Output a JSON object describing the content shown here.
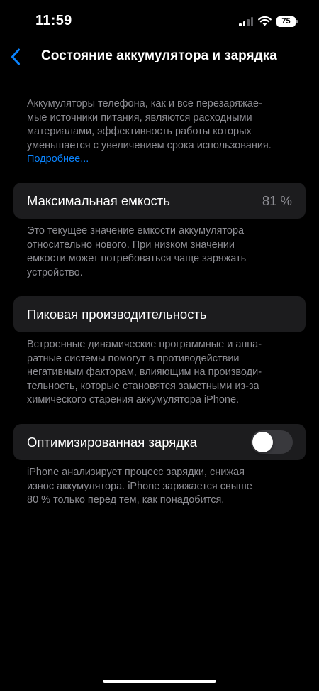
{
  "status_bar": {
    "time": "11:59",
    "battery_level": "75"
  },
  "nav": {
    "title": "Состояние аккумулятора и зарядка"
  },
  "intro": {
    "lines": [
      "Аккумуляторы телефона, как и все перезаряжае-",
      "мые источники питания, являются расходными",
      "материалами, эффективность работы которых",
      "уменьшается с увеличением срока использования."
    ],
    "link_label": "Подробнее..."
  },
  "max_capacity": {
    "label": "Максимальная емкость",
    "value": "81 %",
    "footnote": [
      "Это текущее значение емкости аккумулятора",
      "относительно нового. При низком значении",
      "емкости может потребоваться чаще заряжать",
      "устройство."
    ]
  },
  "peak_performance": {
    "label": "Пиковая производительность",
    "footnote": [
      "Встроенные динамические программные и аппа-",
      "ратные системы помогут в противодействии",
      "негативным факторам, влияющим на производи-",
      "тельность, которые становятся заметными из-за",
      "химического старения аккумулятора iPhone."
    ]
  },
  "optimized_charging": {
    "label": "Оптимизированная зарядка",
    "enabled": false,
    "footnote": [
      "iPhone анализирует процесс зарядки, снижая",
      "износ аккумулятора. iPhone заряжается свыше",
      "80 % только перед тем, как понадобится."
    ]
  },
  "colors": {
    "accent": "#0a84ff",
    "cell_bg": "#1c1c1e",
    "secondary_text": "#8d8d93",
    "toggle_off": "#39393d"
  },
  "icons": {
    "back": "chevron-left-icon",
    "signal": "cellular-signal-icon",
    "wifi": "wifi-icon",
    "battery": "battery-icon"
  }
}
